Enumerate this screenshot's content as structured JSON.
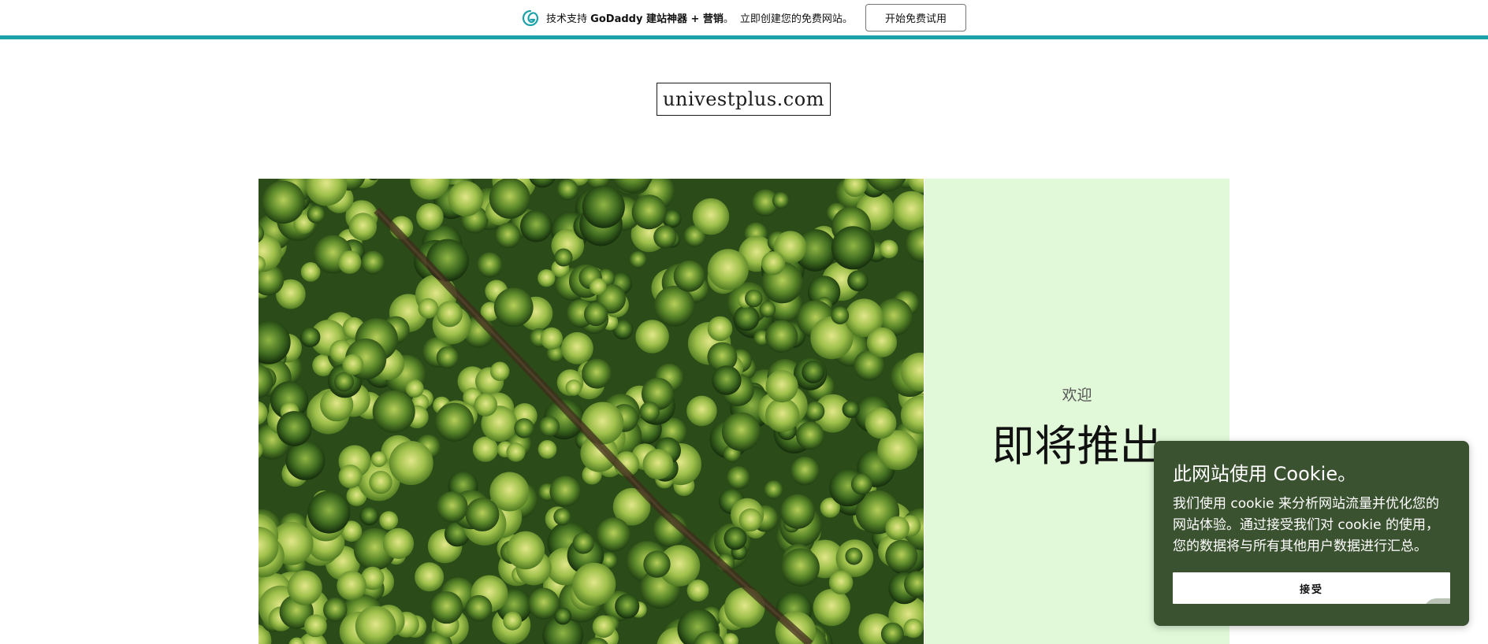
{
  "godaddy_bar": {
    "prefix": "技术支持 ",
    "brand": "GoDaddy 建站神器 + 营销",
    "suffix": "。",
    "cta_text": "立即创建您的免费网站。",
    "button_label": "开始免费试用",
    "accent_color": "#1ba1a8",
    "logo_icon": "godaddy-logo-icon"
  },
  "site": {
    "logo_text": "univestplus.com"
  },
  "hero": {
    "image_subject": "aerial-forest-with-road",
    "panel_color": "#e1f9d9",
    "welcome": "欢迎",
    "title": "即将推出"
  },
  "cookie_banner": {
    "title": "此网站使用 Cookie。",
    "body": "我们使用 cookie 来分析网站流量并优化您的网站体验。通过接受我们对 cookie 的使用，您的数据将与所有其他用户数据进行汇总。",
    "accept_label": "接受",
    "background": "#3b5230"
  }
}
